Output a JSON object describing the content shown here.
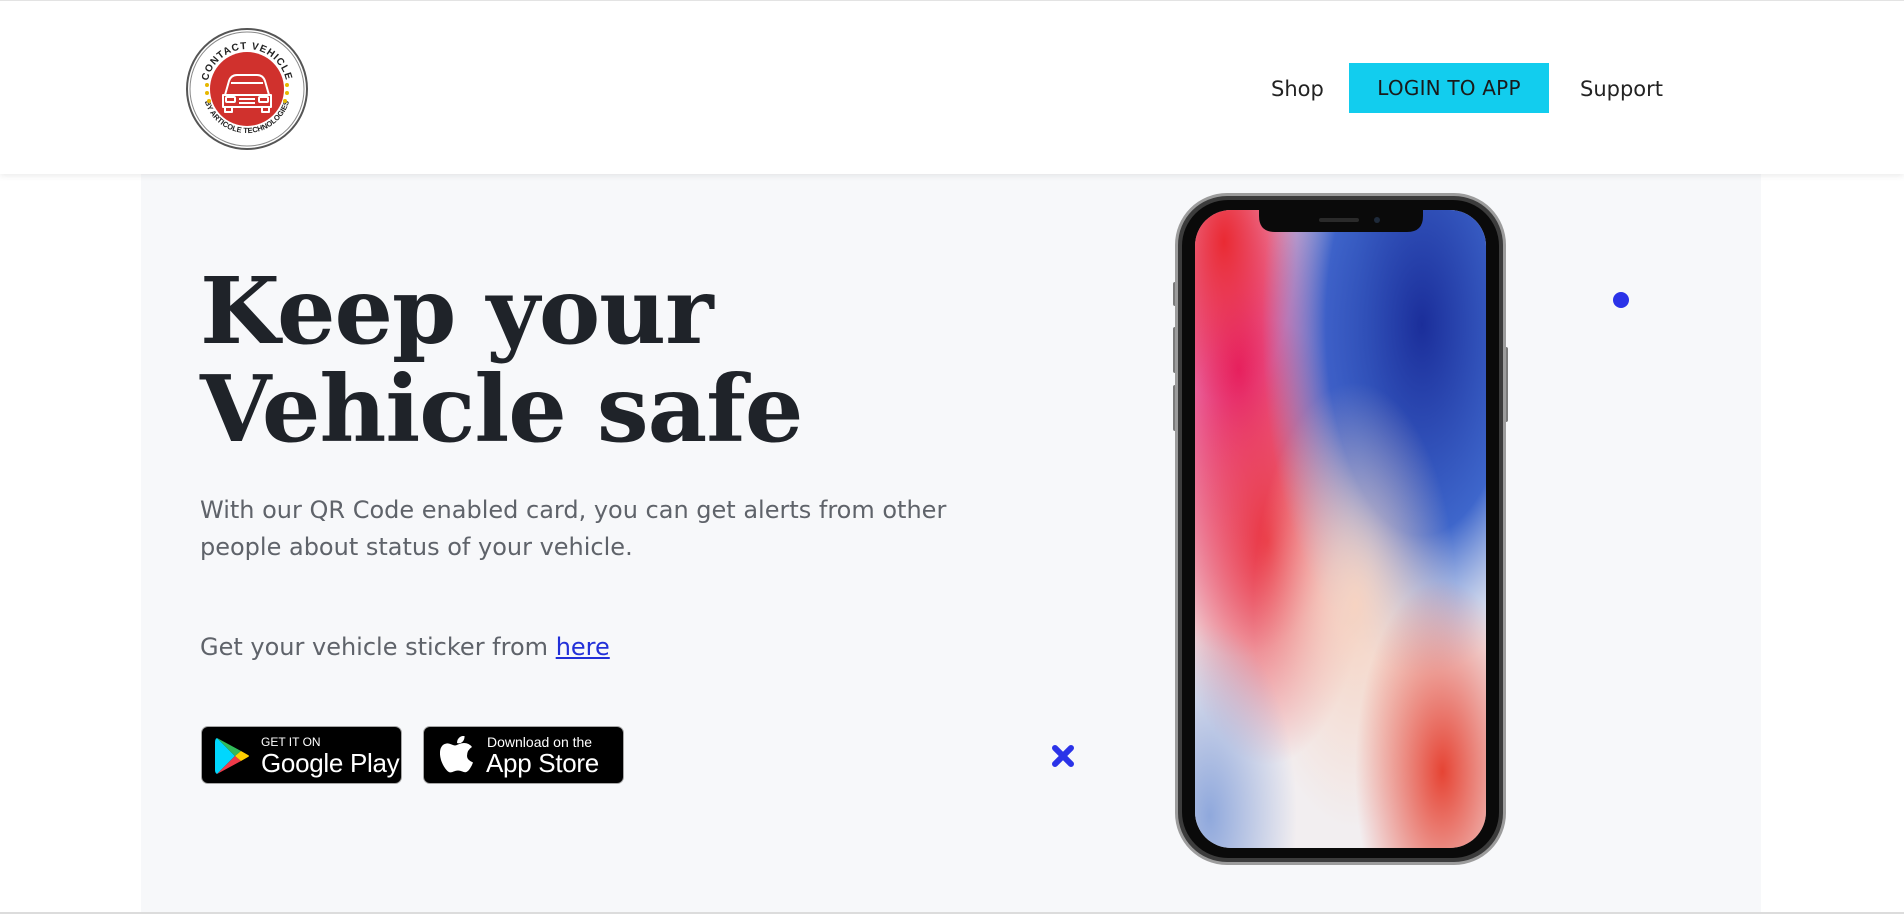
{
  "header": {
    "logo_alt": "CONTACT VEHICLE BY ARTICOLE TECHNOLOGIES",
    "nav": {
      "shop": "Shop",
      "login": "LOGIN TO APP",
      "support": "Support"
    }
  },
  "hero": {
    "headline_line1": "Keep your",
    "headline_line2": "Vehicle safe",
    "description": "With our QR Code enabled card, you can get alerts from other people about status of your vehicle.",
    "sticker_prefix": "Get your vehicle sticker from",
    "sticker_link": "here",
    "badges": {
      "google_small": "GET IT ON",
      "google_big": "Google Play",
      "apple_small": "Download on the",
      "apple_big": "App Store"
    }
  },
  "colors": {
    "accent": "#12cdee",
    "link": "#2230d8",
    "logo_red": "#d0312d",
    "deco_blue": "#2b33e8",
    "hero_bg": "#f7f8fa"
  },
  "icons": [
    "contact-vehicle-logo-icon",
    "google-play-icon",
    "apple-icon",
    "dot-decoration-icon",
    "cross-decoration-icon"
  ]
}
